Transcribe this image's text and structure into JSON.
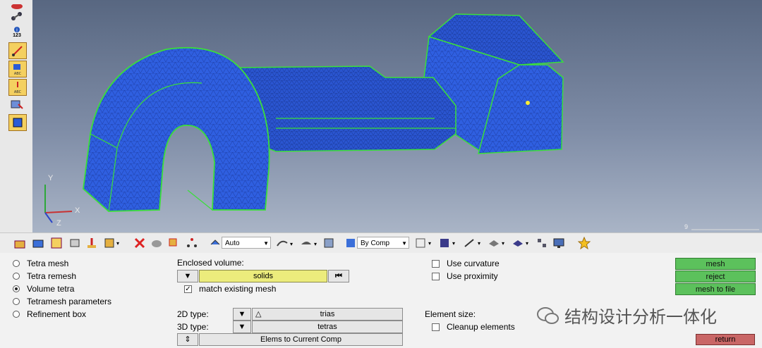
{
  "left_toolbar": {
    "icons": [
      "eye-icon",
      "graph-icon",
      "info-icon",
      "measure-icon",
      "element-label-icon",
      "node-label-icon",
      "mesh-quality-icon",
      "component-icon"
    ],
    "info_label": "123"
  },
  "viewport": {
    "axis": {
      "y": "Y",
      "x": "X",
      "z": "Z"
    },
    "scale_label": "9",
    "colors": {
      "mesh": "#2f5fe0",
      "edge": "#3adf3a",
      "background_top": "#586781"
    }
  },
  "toolbar": {
    "auto_select": "Auto",
    "bycomp_select": "By Comp"
  },
  "panel": {
    "options": [
      {
        "label": "Tetra mesh",
        "selected": false
      },
      {
        "label": "Tetra remesh",
        "selected": false
      },
      {
        "label": "Volume tetra",
        "selected": true
      },
      {
        "label": "Tetramesh parameters",
        "selected": false
      },
      {
        "label": "Refinement box",
        "selected": false
      }
    ],
    "enclosed_volume_label": "Enclosed volume:",
    "solids_value": "solids",
    "match_existing_mesh": "match existing mesh",
    "type2d_label": "2D type:",
    "type2d_value": "trias",
    "type3d_label": "3D type:",
    "type3d_value": "tetras",
    "elems_to_comp": "Elems to Current Comp",
    "use_curvature": "Use curvature",
    "use_proximity": "Use proximity",
    "element_size_label": "Element size:",
    "cleanup_elements": "Cleanup elements",
    "buttons": {
      "mesh": "mesh",
      "reject": "reject",
      "mesh_to_file": "mesh to file",
      "return": "return"
    },
    "watermark": "结构设计分析一体化"
  }
}
